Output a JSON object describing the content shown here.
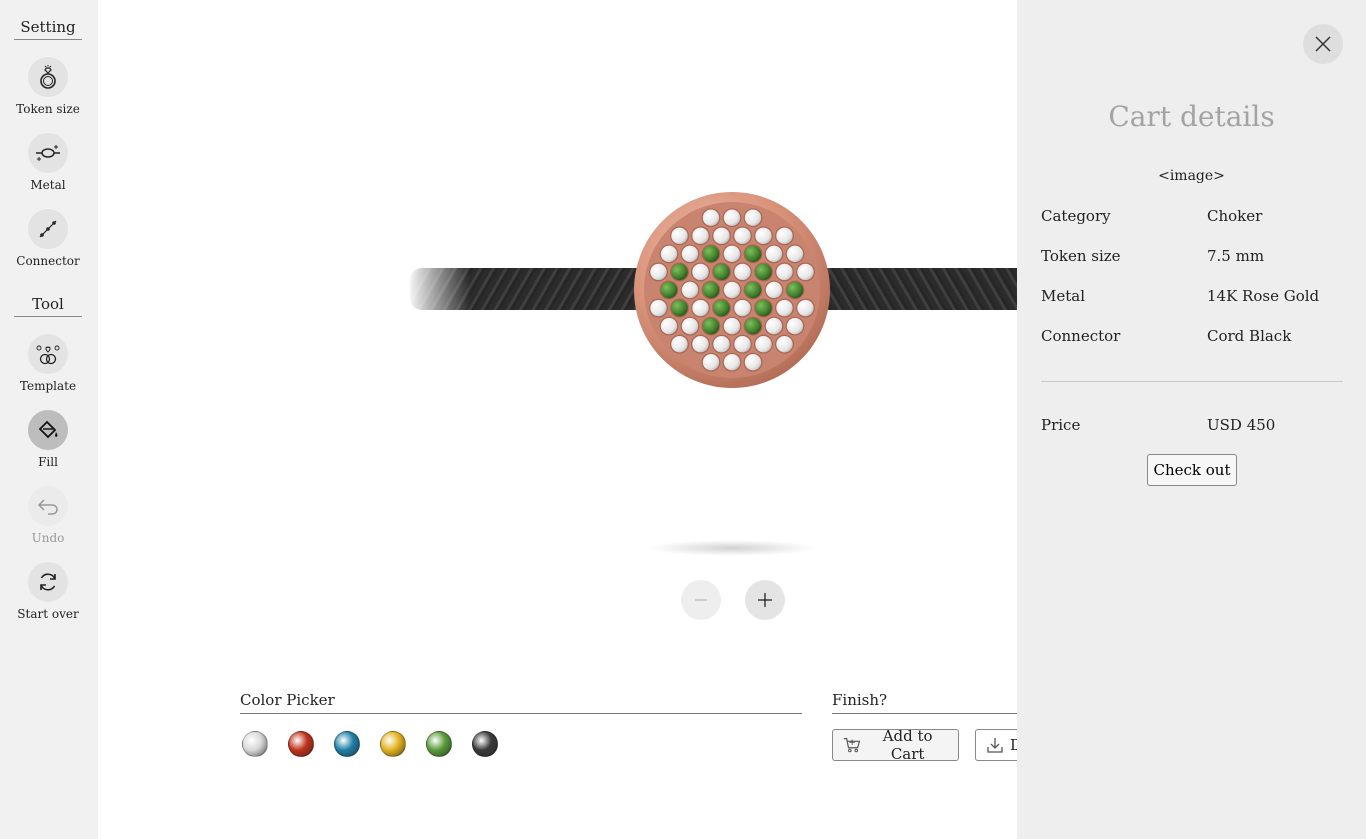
{
  "sidebar": {
    "setting_heading": "Setting",
    "tool_heading": "Tool",
    "items": [
      {
        "label": "Token size",
        "icon": "ring-icon"
      },
      {
        "label": "Metal",
        "icon": "metal-icon"
      },
      {
        "label": "Connector",
        "icon": "chain-icon"
      },
      {
        "label": "Template",
        "icon": "template-icon"
      },
      {
        "label": "Fill",
        "icon": "fill-bucket-icon"
      },
      {
        "label": "Undo",
        "icon": "undo-icon"
      },
      {
        "label": "Start over",
        "icon": "refresh-icon"
      }
    ]
  },
  "color_picker": {
    "title": "Color Picker",
    "swatches": [
      "#d8d8d8",
      "#c0321a",
      "#1f7fa8",
      "#e2b21e",
      "#5a9a3a",
      "#3a3a3a"
    ]
  },
  "finish": {
    "title": "Finish?",
    "add_to_cart": "Add to Cart",
    "download": "D"
  },
  "cart": {
    "title": "Cart details",
    "image_placeholder": "<image>",
    "rows": [
      {
        "key": "Category",
        "value": "Choker"
      },
      {
        "key": "Token size",
        "value": "7.5 mm"
      },
      {
        "key": "Metal",
        "value": "14K Rose Gold"
      },
      {
        "key": "Connector",
        "value": "Cord Black"
      }
    ],
    "price_label": "Price",
    "price_value": "USD 450",
    "checkout": "Check out"
  },
  "token": {
    "metal_color": "#d9927a",
    "stone_white": "#f2f2f2",
    "stone_green": "#3e7d2c"
  }
}
